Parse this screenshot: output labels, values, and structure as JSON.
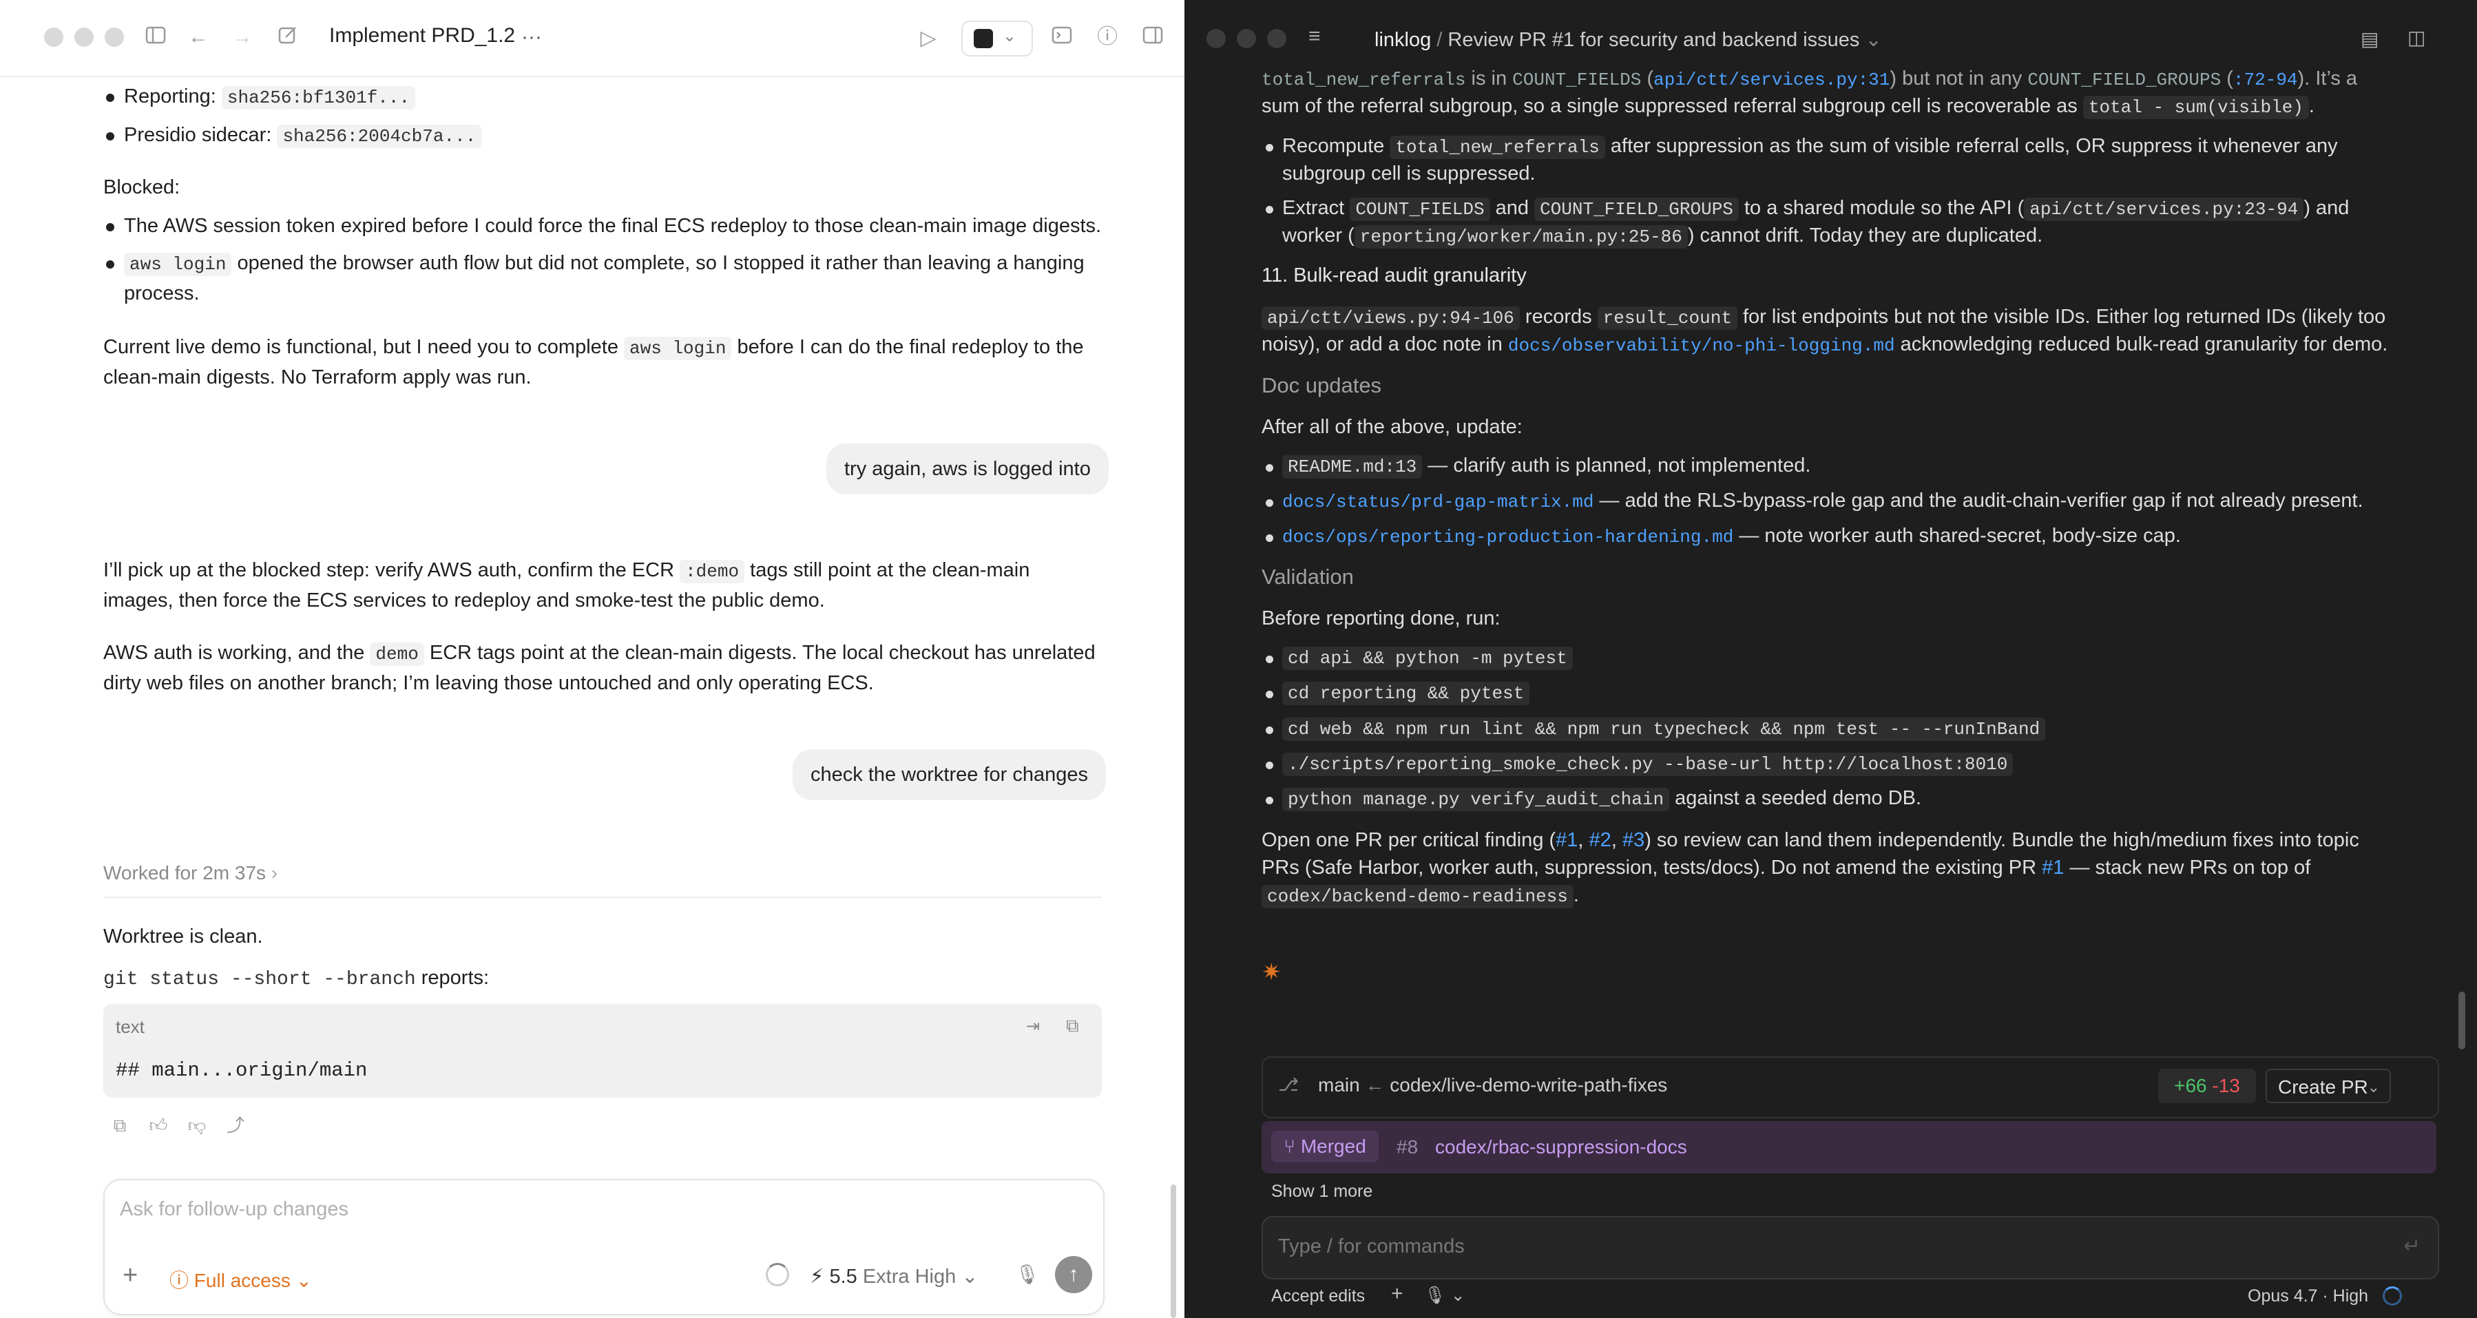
{
  "colors": {
    "accent_orange": "#e0731f",
    "link_blue": "#4ea1ff",
    "diff_add": "#4cc46a",
    "diff_del": "#f0555a",
    "merged_purple": "#c79cf0"
  },
  "left": {
    "title": "Implement PRD_1.2",
    "more": "···",
    "top_bullets": [
      {
        "label": "Reporting:",
        "code": "sha256:bf1301f..."
      },
      {
        "label": "Presidio sidecar:",
        "code": "sha256:2004cb7a..."
      }
    ],
    "blocked_heading": "Blocked:",
    "blocked_1": "The AWS session token expired before I could force the final ECS redeploy to those clean-main image digests.",
    "blocked_2_code": "aws login",
    "blocked_2_line1": "opened the browser auth flow but did not complete, so I stopped it rather than leaving a hanging",
    "blocked_2_line2": "process.",
    "status_p1_a": "Current live demo is functional, but I need you to complete",
    "status_p1_code": "aws login",
    "status_p1_b": "before I can do the final redeploy to the",
    "status_p1_line2": "clean-main digests. No Terraform apply was run.",
    "user_msg_1": "try again, aws is logged into",
    "resp_1_a": "I’ll pick up at the blocked step: verify AWS auth, confirm the ECR",
    "resp_1_code": ":demo",
    "resp_1_b": "tags still point at the clean-main",
    "resp_1_line2": "images, then force the ECS services to redeploy and smoke-test the public demo.",
    "resp_2_a": "AWS auth is working, and the",
    "resp_2_code": "demo",
    "resp_2_b": "ECR tags point at the clean-main digests. The local checkout has unrelated",
    "resp_2_line2": "dirty web files on another branch; I’m leaving those untouched and only operating ECS.",
    "user_msg_2": "check the worktree for changes",
    "worked": "Worked for 2m 37s",
    "worktree_clean": "Worktree is clean.",
    "git_cmd": "git status --short --branch",
    "reports": "reports:",
    "code_lang": "text",
    "code_content": "## main...origin/main",
    "composer_placeholder": "Ask for follow-up changes",
    "access_label": "Full access",
    "model_version": "5.5",
    "effort": "Extra High"
  },
  "right": {
    "project": "linklog",
    "thread_title": "Review PR #1 for security and backend issues",
    "intro_code1": "total_new_referrals",
    "intro_t1": "is in",
    "intro_code2": "COUNT_FIELDS",
    "intro_link1": "api/ctt/services.py:31",
    "intro_t2": "but not in any",
    "intro_code3": "COUNT_FIELD_GROUPS",
    "intro_link2": ":72-94",
    "intro_t3": ". It’s a",
    "intro_line2_a": "sum of the referral subgroup, so a single suppressed referral subgroup cell is recoverable as",
    "intro_line2_code": "total - sum(visible)",
    "b1_a": "Recompute",
    "b1_code": "total_new_referrals",
    "b1_b": "after suppression as the sum of visible referral cells, OR suppress it whenever any",
    "b1_line2": "subgroup cell is suppressed.",
    "b2_a": "Extract",
    "b2_code1": "COUNT_FIELDS",
    "b2_and": "and",
    "b2_code2": "COUNT_FIELD_GROUPS",
    "b2_b": "to a shared module so the API (",
    "b2_code3": "api/ctt/services.py:23-94",
    "b2_c": ") and",
    "b2_line2_a": "worker (",
    "b2_line2_code": "reporting/worker/main.py:25-86",
    "b2_line2_b": ") cannot drift. Today they are duplicated.",
    "h11": "11. Bulk-read audit granularity",
    "p11_code1": "api/ctt/views.py:94-106",
    "p11_a": "records",
    "p11_code2": "result_count",
    "p11_b": "for list endpoints but not the visible IDs. Either log returned IDs (likely too",
    "p11_line2_a": "noisy), or add a doc note in",
    "p11_line2_link": "docs/observability/no-phi-logging.md",
    "p11_line2_b": "acknowledging reduced bulk-read granularity for demo.",
    "h_doc": "Doc updates",
    "doc_intro": "After all of the above, update:",
    "doc_1_code": "README.md:13",
    "doc_1_text": "— clarify auth is planned, not implemented.",
    "doc_2_link": "docs/status/prd-gap-matrix.md",
    "doc_2_text": "— add the RLS-bypass-role gap and the audit-chain-verifier gap if not already present.",
    "doc_3_link": "docs/ops/reporting-production-hardening.md",
    "doc_3_text": "— note worker auth shared-secret, body-size cap.",
    "h_val": "Validation",
    "val_intro": "Before reporting done, run:",
    "val_cmds": [
      "cd api && python -m pytest",
      "cd reporting && pytest",
      "cd web && npm run lint && npm run typecheck && npm test -- --runInBand",
      "./scripts/reporting_smoke_check.py --base-url http://localhost:8010"
    ],
    "val_last_code": "python manage.py verify_audit_chain",
    "val_last_text": "against a seeded demo DB.",
    "final_a": "Open one PR per critical finding (",
    "final_l1": "#1",
    "final_l2": "#2",
    "final_l3": "#3",
    "final_b": ") so review can land them independently. Bundle the high/medium fixes into topic",
    "final_line2_a": "PRs (Safe Harbor, worker auth, suppression, tests/docs). Do not amend the existing PR",
    "final_line2_link": "#1",
    "final_line2_b": "— stack new PRs on top of",
    "final_line3_code": "codex/backend-demo-readiness",
    "branch_base": "main",
    "branch_arrow": "←",
    "branch_head": "codex/live-demo-write-path-fixes",
    "diff_add": "+66",
    "diff_del": "-13",
    "create_pr": "Create PR",
    "merged_label": "Merged",
    "merged_pr": "#8",
    "merged_branch": "codex/rbac-suppression-docs",
    "show_more": "Show 1 more",
    "input_placeholder": "Type / for commands",
    "accept_edits": "Accept edits",
    "model": "Opus 4.7 · High"
  }
}
